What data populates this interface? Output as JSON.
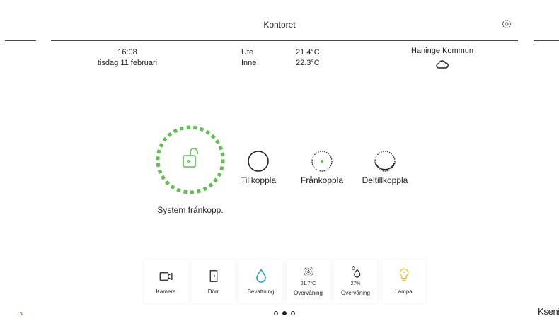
{
  "header": {
    "title": "Kontoret"
  },
  "datetime": {
    "time": "16:08",
    "date": "tisdag 11 februari"
  },
  "climate": {
    "outside_label": "Ute",
    "outside_value": "21.4°C",
    "inside_label": "Inne",
    "inside_value": "22.3°C"
  },
  "weather": {
    "location": "Haninge Kommun",
    "icon": "cloud-icon"
  },
  "system": {
    "status": "System frånkopp.",
    "accent": "#5cc04a"
  },
  "modes": [
    {
      "label": "Tillkoppla"
    },
    {
      "label": "Frånkoppla"
    },
    {
      "label": "Deltillkoppla"
    }
  ],
  "tiles": [
    {
      "label": "Kamera",
      "icon": "camera-icon"
    },
    {
      "label": "Dörr",
      "icon": "door-icon"
    },
    {
      "label": "Bevattning",
      "icon": "water-drop-icon",
      "color": "#1ea3c8"
    },
    {
      "label": "Övervåning",
      "value": "21.7°C",
      "icon": "thermostat-icon"
    },
    {
      "label": "Övervåning",
      "value": "27%",
      "icon": "humidity-icon"
    },
    {
      "label": "Lampa",
      "icon": "lamp-icon",
      "color": "#f0c419"
    }
  ],
  "pagination": {
    "pages": 3,
    "current": 2
  },
  "brand": {
    "name": "Ksenia"
  }
}
